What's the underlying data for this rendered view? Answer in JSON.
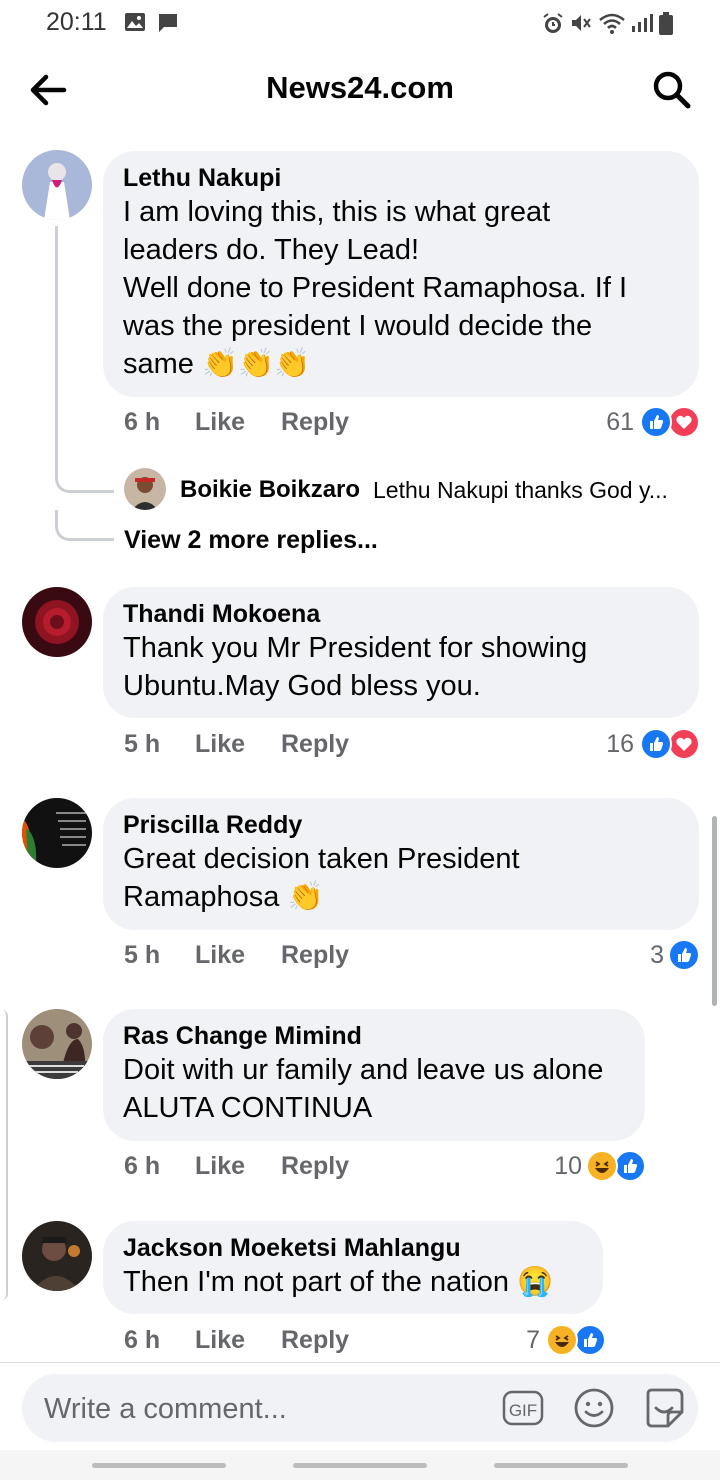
{
  "status_bar": {
    "time": "20:11"
  },
  "header": {
    "title": "News24.com",
    "back_icon": "arrow-left-icon",
    "search_icon": "search-icon"
  },
  "colors": {
    "like_blue": "#1877f2",
    "love_red": "#f33e58",
    "haha_yellow": "#f7b125",
    "bubble_gray": "#f0f2f5",
    "meta_gray": "#65676b"
  },
  "comments": [
    {
      "author": "Lethu Nakupi",
      "lines": [
        "I am loving this, this is what great",
        "leaders do. They Lead!",
        "Well done to President Ramaphosa. If I",
        "was the president I would decide the",
        "same"
      ],
      "emoji": "👏👏👏",
      "time": "6 h",
      "like": "Like",
      "reply": "Reply",
      "reaction_count": "61",
      "reactions": [
        "like",
        "love"
      ],
      "reply_preview": {
        "author": "Boikie Boikzaro",
        "text": "Lethu Nakupi thanks God y..."
      },
      "view_more": "View 2 more replies..."
    },
    {
      "author": "Thandi Mokoena",
      "lines": [
        "Thank you Mr President for showing",
        "Ubuntu.May God bless you."
      ],
      "time": "5 h",
      "like": "Like",
      "reply": "Reply",
      "reaction_count": "16",
      "reactions": [
        "like",
        "love"
      ]
    },
    {
      "author": "Priscilla Reddy",
      "lines": [
        "Great decision taken President",
        "Ramaphosa"
      ],
      "emoji": "👏",
      "time": "5 h",
      "like": "Like",
      "reply": "Reply",
      "reaction_count": "3",
      "reactions": [
        "like"
      ]
    },
    {
      "author": "Ras Change Mimind",
      "lines": [
        "Doit with ur family and leave us alone",
        "ALUTA CONTINUA"
      ],
      "time": "6 h",
      "like": "Like",
      "reply": "Reply",
      "reaction_count": "10",
      "reactions": [
        "haha",
        "like"
      ]
    },
    {
      "author": "Jackson Moeketsi Mahlangu",
      "lines": [
        "Then I'm not part of the nation"
      ],
      "emoji": "😭",
      "time": "6 h",
      "like": "Like",
      "reply": "Reply",
      "reaction_count": "7",
      "reactions": [
        "haha",
        "like"
      ]
    }
  ],
  "composer": {
    "placeholder": "Write a comment...",
    "gif_label": "GIF"
  }
}
